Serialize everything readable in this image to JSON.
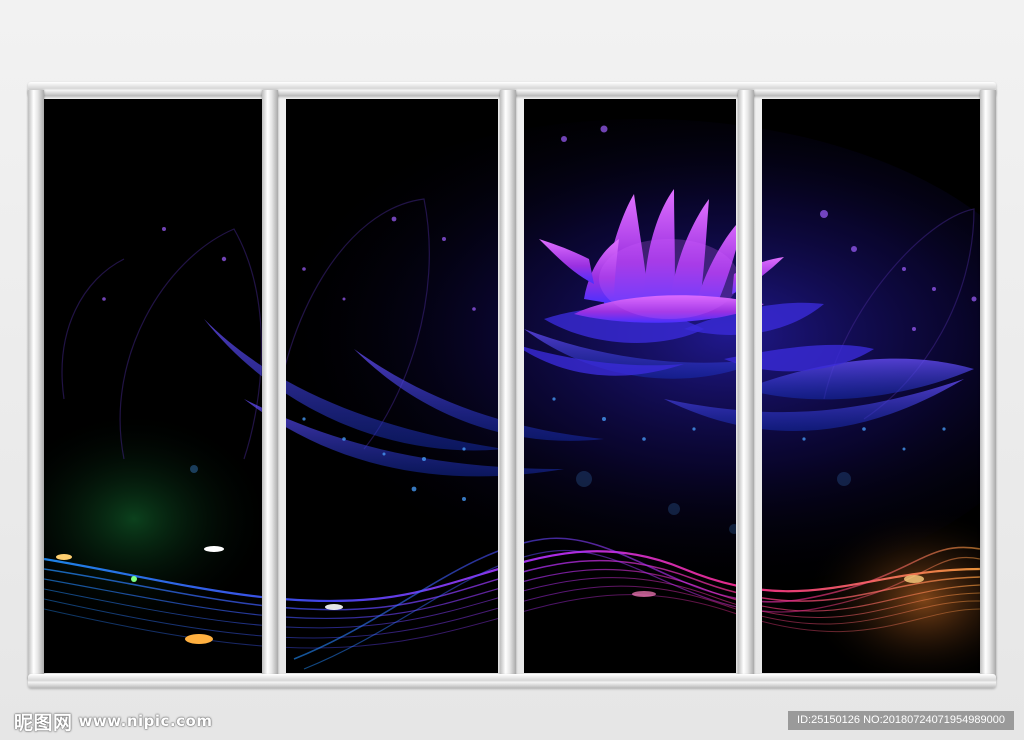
{
  "watermark": {
    "brand_cn": "昵图网",
    "url": "www.nipic.com"
  },
  "id_label": "ID:25150126 NO:20180724071954989000",
  "colors": {
    "frame": "#d9d9d9",
    "background": "#000000",
    "violet": "#b040ff",
    "blue": "#2a4cff",
    "magenta": "#ff2fa8",
    "orange": "#ff9a3a"
  }
}
